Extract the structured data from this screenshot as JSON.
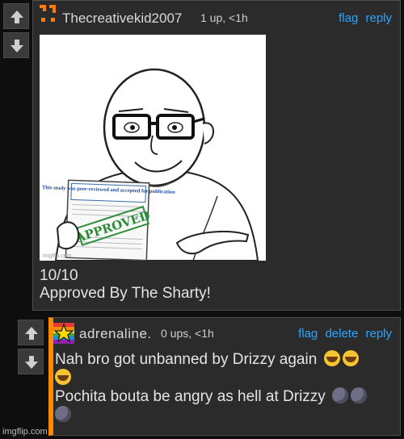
{
  "comments": [
    {
      "username": "Thecreativekid2007",
      "meta": "1 up, <1h",
      "actions": [
        "flag",
        "reply"
      ],
      "image": {
        "paper_text": "This study was peer-reviewed and accepted for publication",
        "stamp_text": "APPROVED",
        "watermark": "imgflip.com"
      },
      "body_lines": [
        "10/10",
        "Approved By The Sharty!"
      ]
    },
    {
      "username": "adrenaline.",
      "meta": "0 ups, <1h",
      "actions": [
        "flag",
        "delete",
        "reply"
      ],
      "body_lines": [
        "Nah bro got unbanned by Drizzy again",
        "Pochita bouta be angry as hell at Drizzy"
      ],
      "accent_color": "#ff8a00"
    }
  ],
  "watermark": "imgflip.com"
}
